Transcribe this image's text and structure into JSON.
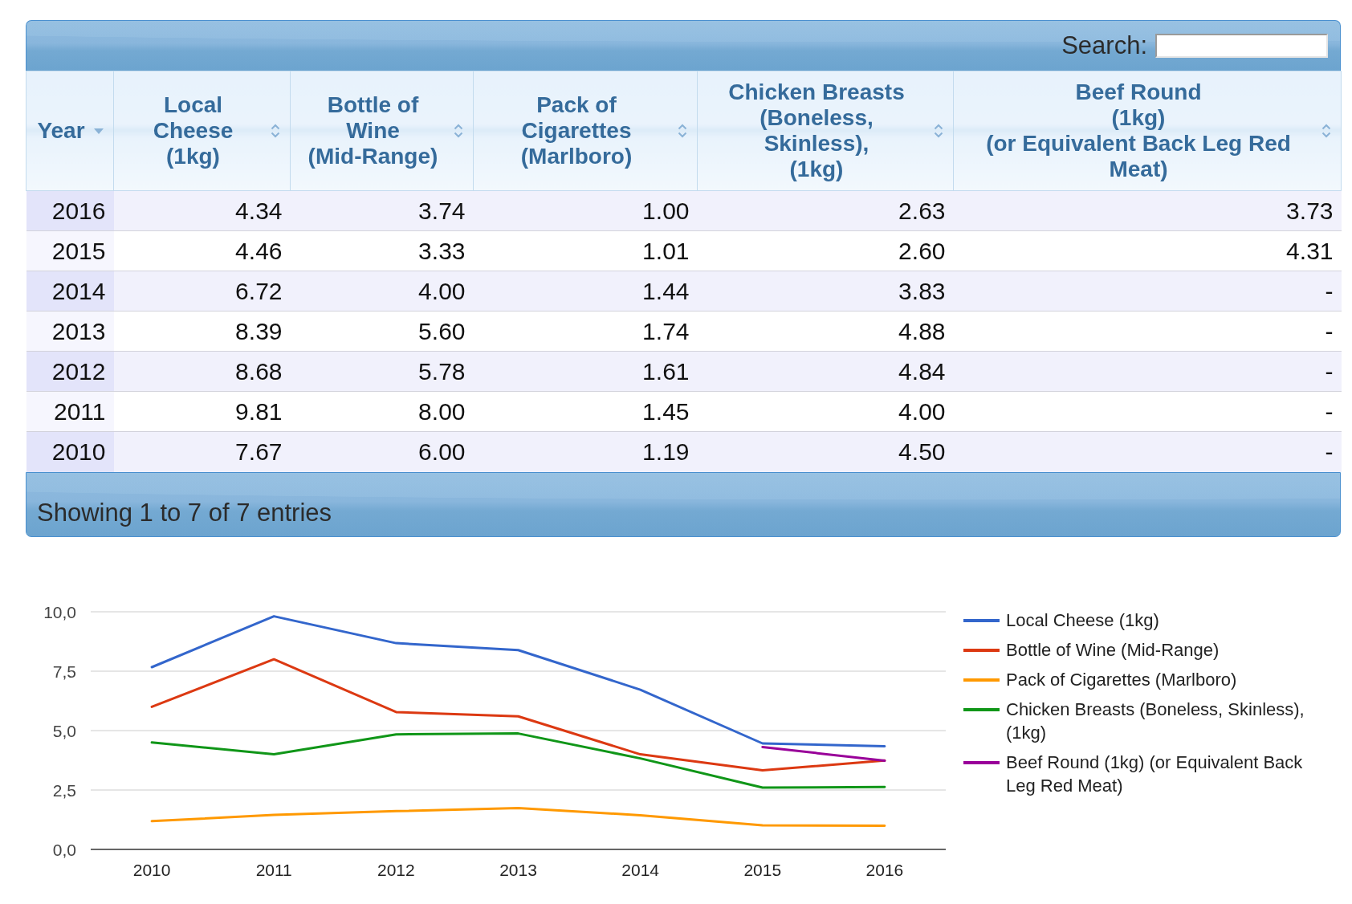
{
  "table": {
    "search": {
      "label": "Search:"
    },
    "columns": [
      {
        "label": "Year",
        "sorted": true,
        "descending": true
      },
      {
        "label": "Local\nCheese\n(1kg)",
        "sorted": false
      },
      {
        "label": "Bottle of\nWine\n(Mid-Range)",
        "sorted": false
      },
      {
        "label": "Pack of\nCigarettes\n(Marlboro)",
        "sorted": false
      },
      {
        "label": "Chicken Breasts\n(Boneless,\nSkinless),\n(1kg)",
        "sorted": false
      },
      {
        "label": "Beef Round\n(1kg)\n(or Equivalent Back Leg Red\nMeat)",
        "sorted": false
      }
    ],
    "rows": [
      [
        "2016",
        "4.34",
        "3.74",
        "1.00",
        "2.63",
        "3.73"
      ],
      [
        "2015",
        "4.46",
        "3.33",
        "1.01",
        "2.60",
        "4.31"
      ],
      [
        "2014",
        "6.72",
        "4.00",
        "1.44",
        "3.83",
        "-"
      ],
      [
        "2013",
        "8.39",
        "5.60",
        "1.74",
        "4.88",
        "-"
      ],
      [
        "2012",
        "8.68",
        "5.78",
        "1.61",
        "4.84",
        "-"
      ],
      [
        "2011",
        "9.81",
        "8.00",
        "1.45",
        "4.00",
        "-"
      ],
      [
        "2010",
        "7.67",
        "6.00",
        "1.19",
        "4.50",
        "-"
      ]
    ],
    "info": "Showing 1 to 7 of 7 entries"
  },
  "chart": {
    "chart_data": {
      "type": "line",
      "categories": [
        "2010",
        "2011",
        "2012",
        "2013",
        "2014",
        "2015",
        "2016"
      ],
      "series": [
        {
          "name": "Local Cheese (1kg)",
          "color": "#3366cc",
          "values": [
            7.67,
            9.81,
            8.68,
            8.39,
            6.72,
            4.46,
            4.34
          ]
        },
        {
          "name": "Bottle of Wine (Mid-Range)",
          "color": "#dc3912",
          "values": [
            6.0,
            8.0,
            5.78,
            5.6,
            4.0,
            3.33,
            3.74
          ]
        },
        {
          "name": "Pack of Cigarettes (Marlboro)",
          "color": "#ff9900",
          "values": [
            1.19,
            1.45,
            1.61,
            1.74,
            1.44,
            1.01,
            1.0
          ]
        },
        {
          "name": "Chicken Breasts (Boneless, Skinless), (1kg)",
          "color": "#109618",
          "values": [
            4.5,
            4.0,
            4.84,
            4.88,
            3.83,
            2.6,
            2.63
          ]
        },
        {
          "name": "Beef Round (1kg) (or Equivalent Back Leg Red Meat)",
          "color": "#990099",
          "values": [
            null,
            null,
            null,
            null,
            null,
            4.31,
            3.73
          ]
        }
      ],
      "ylim": [
        0,
        10
      ],
      "yticks": [
        {
          "value": 0,
          "label": "0,0"
        },
        {
          "value": 2.5,
          "label": "2,5"
        },
        {
          "value": 5,
          "label": "5,0"
        },
        {
          "value": 7.5,
          "label": "7,5"
        },
        {
          "value": 10,
          "label": "10,0"
        }
      ],
      "grid": true,
      "legend": true
    }
  }
}
